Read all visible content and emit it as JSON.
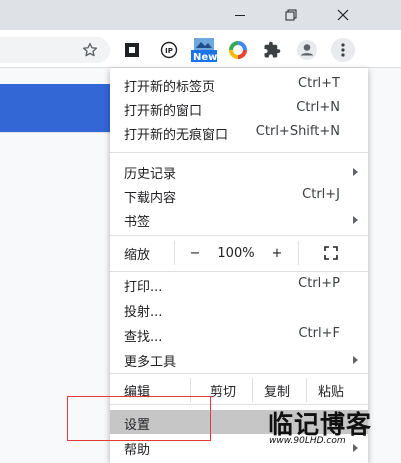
{
  "toolbar": {
    "new_badge": "New"
  },
  "menu": {
    "new_tab": {
      "label": "打开新的标签页",
      "shortcut": "Ctrl+T"
    },
    "new_window": {
      "label": "打开新的窗口",
      "shortcut": "Ctrl+N"
    },
    "incognito": {
      "label": "打开新的无痕窗口",
      "shortcut": "Ctrl+Shift+N"
    },
    "history": {
      "label": "历史记录"
    },
    "downloads": {
      "label": "下载内容",
      "shortcut": "Ctrl+J"
    },
    "bookmarks": {
      "label": "书签"
    },
    "zoom": {
      "label": "缩放",
      "minus": "−",
      "value": "100%",
      "plus": "+"
    },
    "print": {
      "label": "打印...",
      "shortcut": "Ctrl+P"
    },
    "cast": {
      "label": "投射..."
    },
    "find": {
      "label": "查找...",
      "shortcut": "Ctrl+F"
    },
    "more_tools": {
      "label": "更多工具"
    },
    "edit": {
      "label": "编辑",
      "cut": "剪切",
      "copy": "复制",
      "paste": "粘贴"
    },
    "settings": {
      "label": "设置"
    },
    "help": {
      "label": "帮助"
    }
  },
  "watermark": {
    "title": "临记博客",
    "url": "www.90LHD.com"
  },
  "colors": {
    "accent_blue": "#3367d6",
    "highlight_red": "#e53935",
    "settings_bg": "#c6c6c6"
  },
  "icons": [
    "minimize-icon",
    "maximize-icon",
    "close-icon",
    "bookmark-star-icon",
    "extension-square-icon",
    "ip-icon",
    "new-extension-icon",
    "color-ring-icon",
    "puzzle-icon",
    "profile-icon",
    "kebab-menu-icon",
    "fullscreen-icon"
  ]
}
